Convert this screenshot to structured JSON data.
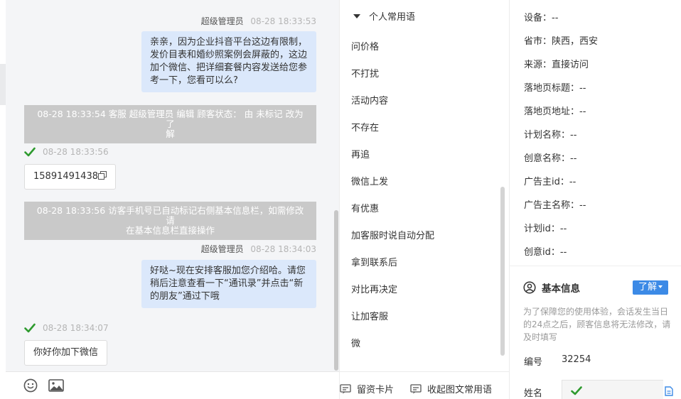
{
  "chat": {
    "messages": [
      {
        "type": "agent",
        "sender": "超级管理员",
        "time": "08-28 18:33:53",
        "lines": [
          "亲亲，因为企业抖音平台这边有限制，",
          "发价目表和婚纱照案例会屏蔽的，这边",
          "加个微信、把详细套餐内容发送给您参",
          "考一下，您看可以么?"
        ]
      },
      {
        "type": "system",
        "lines": [
          "08-28 18:33:54 客服 超级管理员 编辑 顾客状态： 由 未标记 改为 了",
          "解"
        ]
      },
      {
        "type": "visitor",
        "time": "08-28 18:33:56",
        "text": "15891491438"
      },
      {
        "type": "system",
        "lines": [
          "08-28 18:33:56 访客手机号已自动标记右侧基本信息栏，如需修改请",
          "在基本信息栏直接操作"
        ]
      },
      {
        "type": "agent",
        "sender": "超级管理员",
        "time": "08-28 18:34:03",
        "lines": [
          "好哒~现在安排客服加您介绍哈。请您",
          "稍后注意查看一下“通讯录”并点击“新",
          "的朋友”通过下哦"
        ]
      },
      {
        "type": "visitor",
        "time": "08-28 18:34:07",
        "text": "你好你加下微信"
      }
    ],
    "toolbar": {
      "emoji_icon": "smile-icon",
      "image_icon": "image-icon"
    }
  },
  "phrases": {
    "title": "个人常用语",
    "items": [
      "问价格",
      "不打扰",
      "活动内容",
      "不存在",
      "再追",
      "微信上发",
      "有优惠",
      "加客服时说自动分配",
      "拿到联系后",
      "对比再决定",
      "让加客服",
      "微"
    ],
    "bottom": {
      "card_label": "留资卡片",
      "collapse_label": "收起图文常用语"
    }
  },
  "info": {
    "rows": [
      {
        "label": "设备：",
        "value": "--"
      },
      {
        "label": "省市：",
        "value": "陕西，西安"
      },
      {
        "label": "来源：",
        "value": "直接访问"
      },
      {
        "label": "落地页标题：",
        "value": "--"
      },
      {
        "label": "落地页地址：",
        "value": "--"
      },
      {
        "label": "计划名称：",
        "value": "--"
      },
      {
        "label": "创意名称：",
        "value": "--"
      },
      {
        "label": "广告主id：",
        "value": "--"
      },
      {
        "label": "广告主名称：",
        "value": "--"
      },
      {
        "label": "计划id：",
        "value": "--"
      },
      {
        "label": "创意id：",
        "value": "--"
      }
    ],
    "basic": {
      "title": "基本信息",
      "learn_label": "了解",
      "note": "为了保障您的使用体验，会话发生当日的24点之后，顾客信息将无法修改，请及时填写",
      "id_label": "编号",
      "id_value": "32254",
      "name_label": "姓名"
    }
  },
  "colors": {
    "accent": "#3c8ae6",
    "bubble": "#dbe8fb",
    "system_bar": "#c9c9c9",
    "check": "#2e9a2e"
  }
}
